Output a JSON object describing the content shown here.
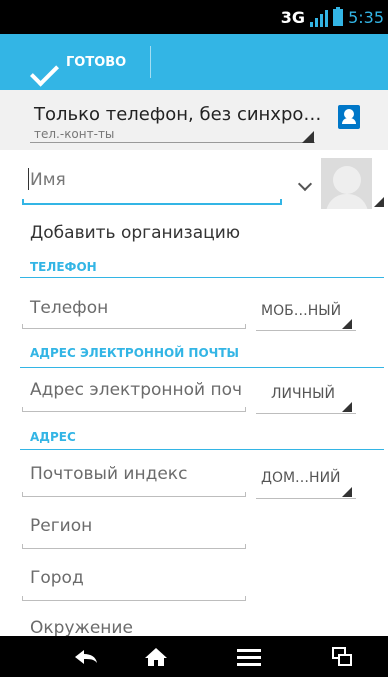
{
  "status_bar": {
    "network": "3G",
    "time": "5:35"
  },
  "action_bar": {
    "done_label": "ГОТОВО"
  },
  "account": {
    "title": "Только телефон, без синхро…",
    "subtitle": "тел.-конт-ты"
  },
  "name_field": {
    "placeholder": "Имя"
  },
  "add_org": "Добавить организацию",
  "sections": {
    "phone": "ТЕЛЕФОН",
    "email": "АДРЕС ЭЛЕКТРОННОЙ ПОЧТЫ",
    "address": "АДРЕС"
  },
  "phone_field": {
    "placeholder": "Телефон",
    "type": "МОБ…НЫЙ"
  },
  "email_field": {
    "placeholder": "Адрес электронной поч",
    "type": "ЛИЧНЫЙ"
  },
  "address_fields": {
    "postcode": "Почтовый индекс",
    "postcode_type": "ДОМ…НИЙ",
    "region": "Регион",
    "city": "Город",
    "neighborhood": "Окружение"
  },
  "colors": {
    "accent": "#33b5e5",
    "contact_icon": "#0077c8"
  },
  "icons": {
    "done": "check-icon",
    "account": "contact-book-icon",
    "photo": "person-placeholder-icon",
    "back": "back-icon",
    "home": "home-icon",
    "menu": "menu-icon",
    "recents": "recent-apps-icon"
  }
}
